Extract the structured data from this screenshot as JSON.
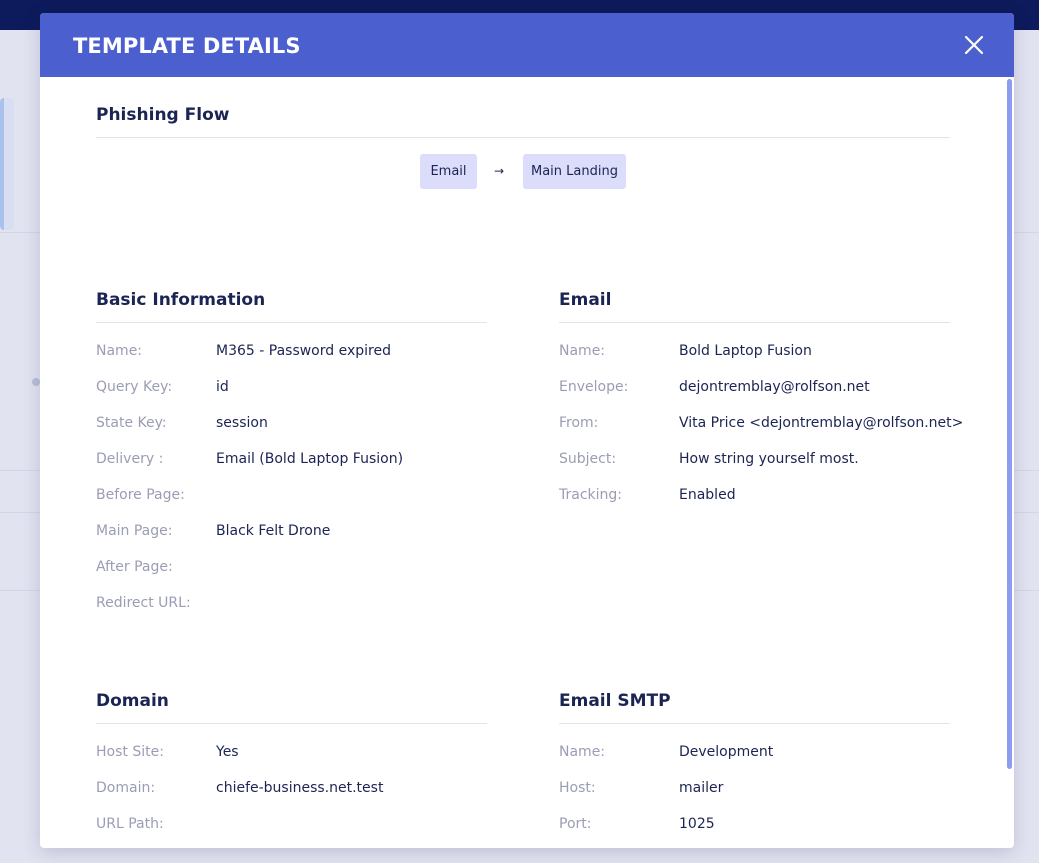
{
  "modal": {
    "title": "TEMPLATE DETAILS"
  },
  "phishing_flow": {
    "title": "Phishing Flow",
    "steps": [
      "Email",
      "Main Landing"
    ],
    "arrow": "→"
  },
  "basic_information": {
    "title": "Basic Information",
    "rows": [
      {
        "label": "Name:",
        "value": "M365 - Password expired"
      },
      {
        "label": "Query Key:",
        "value": "id"
      },
      {
        "label": "State Key:",
        "value": "session"
      },
      {
        "label": "Delivery :",
        "value": "Email (Bold Laptop Fusion)"
      },
      {
        "label": "Before Page:",
        "value": ""
      },
      {
        "label": "Main Page:",
        "value": "Black Felt Drone"
      },
      {
        "label": "After Page:",
        "value": ""
      },
      {
        "label": "Redirect URL:",
        "value": ""
      }
    ]
  },
  "email": {
    "title": "Email",
    "rows": [
      {
        "label": "Name:",
        "value": "Bold Laptop Fusion"
      },
      {
        "label": "Envelope:",
        "value": "dejontremblay@rolfson.net"
      },
      {
        "label": "From:",
        "value": "Vita Price <dejontremblay@rolfson.net>"
      },
      {
        "label": "Subject:",
        "value": "How string yourself most."
      },
      {
        "label": "Tracking:",
        "value": "Enabled"
      }
    ]
  },
  "domain": {
    "title": "Domain",
    "rows": [
      {
        "label": "Host Site:",
        "value": "Yes"
      },
      {
        "label": "Domain:",
        "value": "chiefe-business.net.test"
      },
      {
        "label": "URL Path:",
        "value": ""
      }
    ]
  },
  "email_smtp": {
    "title": "Email SMTP",
    "rows": [
      {
        "label": "Name:",
        "value": "Development"
      },
      {
        "label": "Host:",
        "value": "mailer"
      },
      {
        "label": "Port:",
        "value": "1025"
      }
    ]
  },
  "colors": {
    "header_bg": "#4b5fcf",
    "flow_chip_bg": "#dcdcfb",
    "label_text": "#9a9db3",
    "value_text": "#1c2453"
  },
  "icons": {
    "close": "close-icon"
  }
}
